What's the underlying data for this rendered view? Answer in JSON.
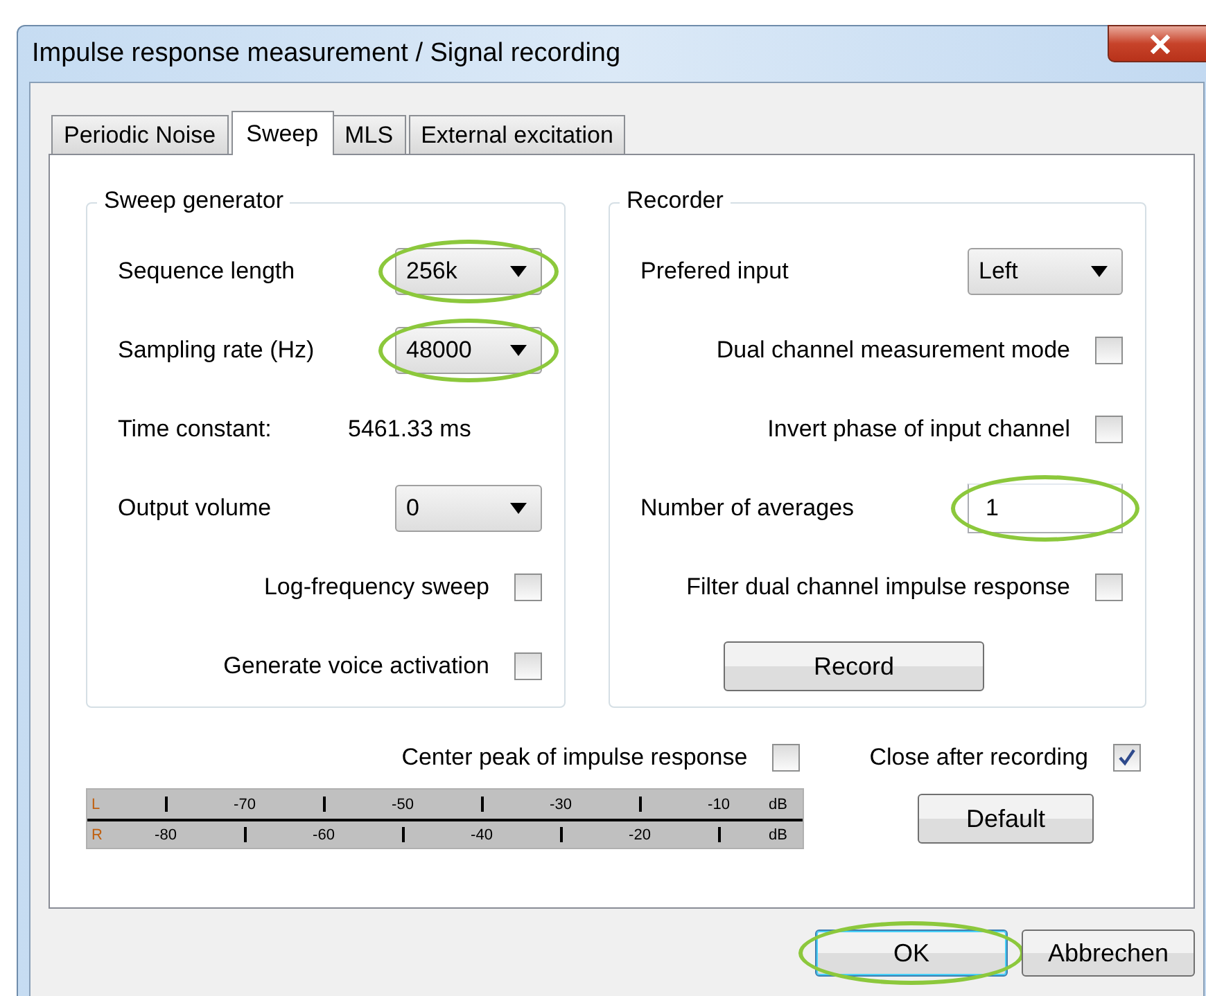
{
  "window": {
    "title": "Impulse response measurement / Signal recording"
  },
  "tabs": [
    {
      "label": "Periodic Noise",
      "selected": false
    },
    {
      "label": "Sweep",
      "selected": true
    },
    {
      "label": "MLS",
      "selected": false
    },
    {
      "label": "External excitation",
      "selected": false
    }
  ],
  "sweep_generator": {
    "title": "Sweep generator",
    "rows": [
      {
        "kind": "combo",
        "label": "Sequence length",
        "value": "256k",
        "highlighted": true
      },
      {
        "kind": "combo",
        "label": "Sampling rate (Hz)",
        "value": "48000",
        "highlighted": true
      },
      {
        "kind": "text",
        "label": "Time constant:",
        "value": "5461.33 ms"
      },
      {
        "kind": "combo",
        "label": "Output volume",
        "value": "0",
        "highlighted": false
      },
      {
        "kind": "check",
        "label": "Log-frequency sweep",
        "checked": false
      },
      {
        "kind": "check",
        "label": "Generate voice activation",
        "checked": false
      }
    ]
  },
  "recorder": {
    "title": "Recorder",
    "rows": [
      {
        "kind": "combo",
        "label": "Prefered input",
        "value": "Left",
        "highlighted": false
      },
      {
        "kind": "check",
        "label": "Dual channel measurement mode",
        "checked": false
      },
      {
        "kind": "check",
        "label": "Invert phase of input channel",
        "checked": false
      },
      {
        "kind": "input",
        "label": "Number of averages",
        "value": "1",
        "highlighted": true
      },
      {
        "kind": "check",
        "label": "Filter dual channel impulse response",
        "checked": false
      },
      {
        "kind": "button",
        "label": "Record"
      }
    ]
  },
  "options": [
    {
      "label": "Center peak of impulse response",
      "checked": false
    },
    {
      "label": "Close after recording",
      "checked": true
    }
  ],
  "level_meter": {
    "rows": [
      {
        "channel": "L",
        "labels_first": false,
        "labels": [
          "-70",
          "-50",
          "-30",
          "-10"
        ],
        "unit": "dB"
      },
      {
        "channel": "R",
        "labels_first": true,
        "labels": [
          "-80",
          "-60",
          "-40",
          "-20"
        ],
        "unit": "dB"
      }
    ]
  },
  "default_button": {
    "label": "Default"
  },
  "footer_buttons": [
    {
      "label": "OK",
      "default": true,
      "highlighted": true
    },
    {
      "label": "Abbrechen",
      "default": false,
      "highlighted": false
    }
  ]
}
